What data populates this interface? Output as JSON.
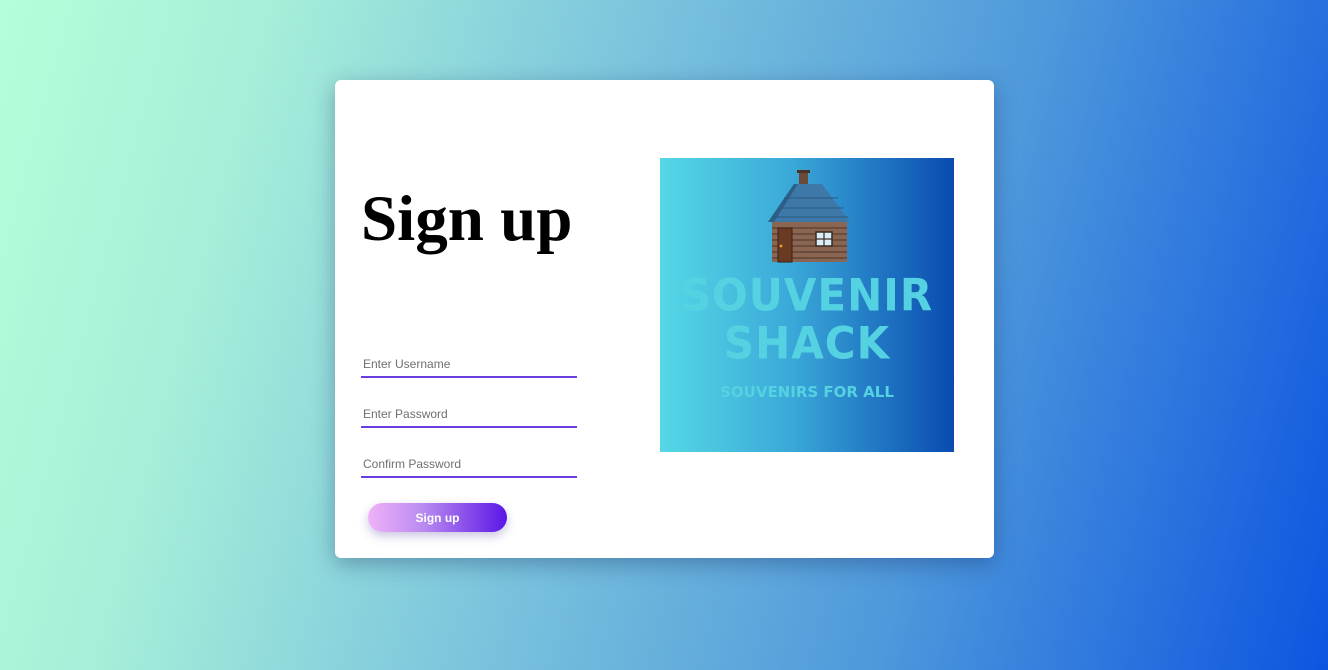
{
  "form": {
    "title": "Sign up",
    "username_placeholder": "Enter Username",
    "password_placeholder": "Enter Password",
    "confirm_placeholder": "Confirm Password",
    "submit_label": "Sign up"
  },
  "logo": {
    "icon": "log-cabin-icon",
    "name_line1": "SOUVENIR",
    "name_line2": "SHACK",
    "tagline": "SOUVENIRS FOR ALL"
  },
  "colors": {
    "accent": "#6a3ee0",
    "button_start": "#efb2f8",
    "button_end": "#5a17e6",
    "logo_text": "#55d2e2"
  }
}
